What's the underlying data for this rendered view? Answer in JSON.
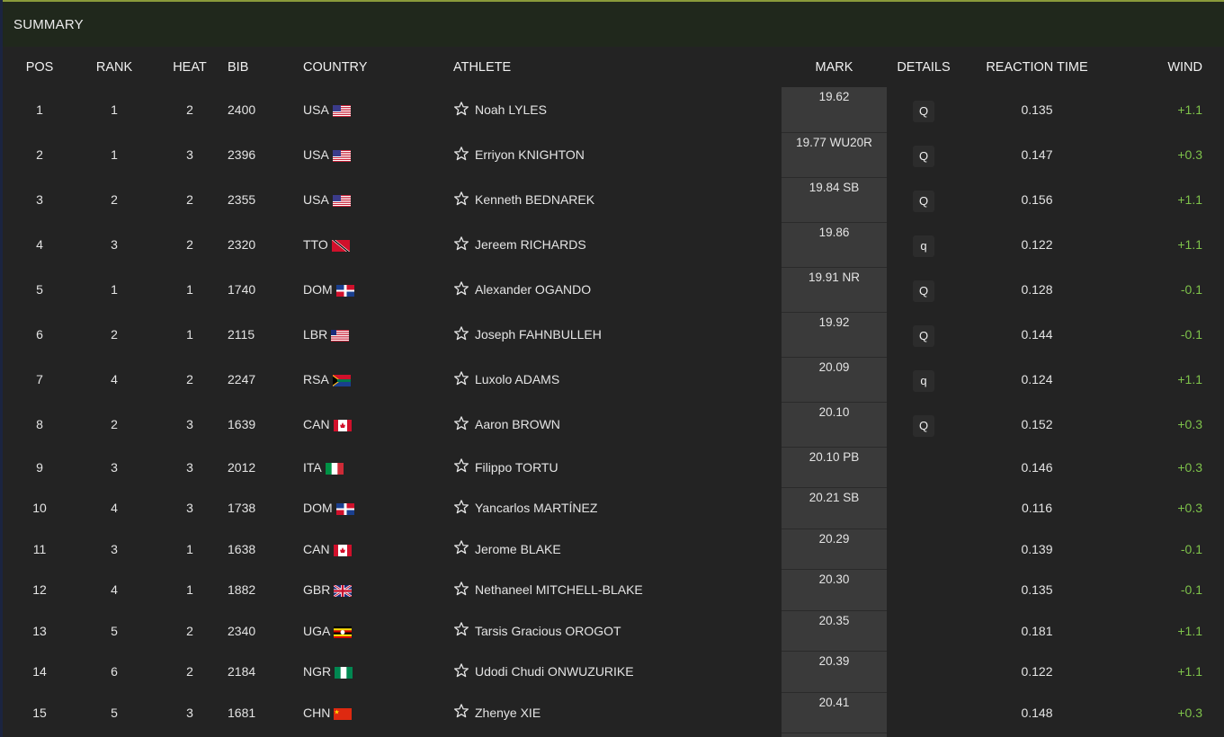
{
  "header": {
    "title": "SUMMARY"
  },
  "columns": {
    "pos": "POS",
    "rank": "RANK",
    "heat": "HEAT",
    "bib": "BIB",
    "country": "COUNTRY",
    "athlete": "ATHLETE",
    "mark": "MARK",
    "details": "DETAILS",
    "reaction": "REACTION TIME",
    "wind": "WIND"
  },
  "colors": {
    "accent_green": "#7ec24a",
    "mark_column": "#3a3a3a",
    "summary_bar": "#20281c"
  },
  "rows": [
    {
      "pos": "1",
      "rank": "1",
      "heat": "2",
      "bib": "2400",
      "country": "USA",
      "flag": "usa-flag",
      "athlete": "Noah LYLES",
      "mark": "19.62",
      "details": "Q",
      "reaction": "0.135",
      "wind": "+1.1"
    },
    {
      "pos": "2",
      "rank": "1",
      "heat": "3",
      "bib": "2396",
      "country": "USA",
      "flag": "usa-flag",
      "athlete": "Erriyon KNIGHTON",
      "mark": "19.77 WU20R",
      "details": "Q",
      "reaction": "0.147",
      "wind": "+0.3"
    },
    {
      "pos": "3",
      "rank": "2",
      "heat": "2",
      "bib": "2355",
      "country": "USA",
      "flag": "usa-flag",
      "athlete": "Kenneth BEDNAREK",
      "mark": "19.84 SB",
      "details": "Q",
      "reaction": "0.156",
      "wind": "+1.1"
    },
    {
      "pos": "4",
      "rank": "3",
      "heat": "2",
      "bib": "2320",
      "country": "TTO",
      "flag": "tto-flag",
      "athlete": "Jereem RICHARDS",
      "mark": "19.86",
      "details": "q",
      "reaction": "0.122",
      "wind": "+1.1"
    },
    {
      "pos": "5",
      "rank": "1",
      "heat": "1",
      "bib": "1740",
      "country": "DOM",
      "flag": "dom-flag",
      "athlete": "Alexander OGANDO",
      "mark": "19.91 NR",
      "details": "Q",
      "reaction": "0.128",
      "wind": "-0.1"
    },
    {
      "pos": "6",
      "rank": "2",
      "heat": "1",
      "bib": "2115",
      "country": "LBR",
      "flag": "lbr-flag",
      "athlete": "Joseph FAHNBULLEH",
      "mark": "19.92",
      "details": "Q",
      "reaction": "0.144",
      "wind": "-0.1"
    },
    {
      "pos": "7",
      "rank": "4",
      "heat": "2",
      "bib": "2247",
      "country": "RSA",
      "flag": "rsa-flag",
      "athlete": "Luxolo ADAMS",
      "mark": "20.09",
      "details": "q",
      "reaction": "0.124",
      "wind": "+1.1"
    },
    {
      "pos": "8",
      "rank": "2",
      "heat": "3",
      "bib": "1639",
      "country": "CAN",
      "flag": "can-flag",
      "athlete": "Aaron BROWN",
      "mark": "20.10",
      "details": "Q",
      "reaction": "0.152",
      "wind": "+0.3"
    },
    {
      "pos": "9",
      "rank": "3",
      "heat": "3",
      "bib": "2012",
      "country": "ITA",
      "flag": "ita-flag",
      "athlete": "Filippo TORTU",
      "mark": "20.10 PB",
      "details": "",
      "reaction": "0.146",
      "wind": "+0.3"
    },
    {
      "pos": "10",
      "rank": "4",
      "heat": "3",
      "bib": "1738",
      "country": "DOM",
      "flag": "dom-flag",
      "athlete": "Yancarlos MARTÍNEZ",
      "mark": "20.21 SB",
      "details": "",
      "reaction": "0.116",
      "wind": "+0.3"
    },
    {
      "pos": "11",
      "rank": "3",
      "heat": "1",
      "bib": "1638",
      "country": "CAN",
      "flag": "can-flag",
      "athlete": "Jerome BLAKE",
      "mark": "20.29",
      "details": "",
      "reaction": "0.139",
      "wind": "-0.1"
    },
    {
      "pos": "12",
      "rank": "4",
      "heat": "1",
      "bib": "1882",
      "country": "GBR",
      "flag": "gbr-flag",
      "athlete": "Nethaneel MITCHELL-BLAKE",
      "mark": "20.30",
      "details": "",
      "reaction": "0.135",
      "wind": "-0.1"
    },
    {
      "pos": "13",
      "rank": "5",
      "heat": "2",
      "bib": "2340",
      "country": "UGA",
      "flag": "uga-flag",
      "athlete": "Tarsis Gracious OROGOT",
      "mark": "20.35",
      "details": "",
      "reaction": "0.181",
      "wind": "+1.1"
    },
    {
      "pos": "14",
      "rank": "6",
      "heat": "2",
      "bib": "2184",
      "country": "NGR",
      "flag": "ngr-flag",
      "athlete": "Udodi Chudi ONWUZURIKE",
      "mark": "20.39",
      "details": "",
      "reaction": "0.122",
      "wind": "+1.1"
    },
    {
      "pos": "15",
      "rank": "5",
      "heat": "3",
      "bib": "1681",
      "country": "CHN",
      "flag": "chn-flag",
      "athlete": "Zhenye XIE",
      "mark": "20.41",
      "details": "",
      "reaction": "0.148",
      "wind": "+0.3"
    }
  ]
}
